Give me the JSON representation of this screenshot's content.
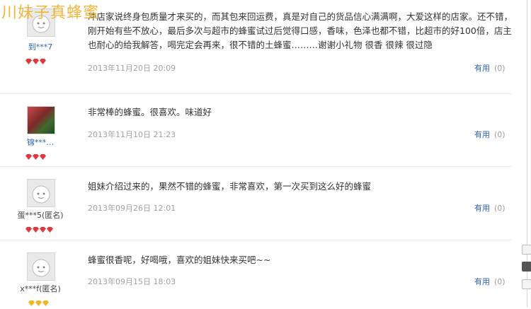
{
  "watermark": "川妹子真蜂蜜",
  "useful_label": "有用",
  "reviews": [
    {
      "user": "到***7",
      "avatar": "default-avatar",
      "rank_color": "#e0383e",
      "content": "冲店家说终身包质量才来买的，而其包来回运费，真是对自己的货品信心满满啊，大爱这样的店家。还不错，刚开始有些不放心，最后多次与超市的蜂蜜试过后觉得口感，香味，色泽也都不错，比超市的好100倍，店主也耐心的给我解答，喝完定会再来，很不错的土蜂蜜………谢谢小礼物 很香 很辣 很过隐",
      "date": "2013年11月20日 20:09",
      "useful_count": "(0)"
    },
    {
      "user": "锦***…",
      "avatar": "photo-avatar",
      "rank_color": "#e0383e",
      "content": "非常棒的蜂蜜。很喜欢。味道好",
      "date": "2013年11月10日 21:23",
      "useful_count": "(0)"
    },
    {
      "user": "蛋***5(匿名)",
      "avatar": "default-avatar",
      "rank_color": "#e0383e",
      "content": "姐妹介绍过来的，果然不错的蜂蜜，非常喜欢，第一次买到这么好的蜂蜜",
      "date": "2013年09月26日 12:01",
      "useful_count": "(0)"
    },
    {
      "user": "x***f(匿名)",
      "avatar": "default-avatar",
      "rank_color": "#f0b71e",
      "content": "蜂蜜很香呢，好喝哦，喜欢的姐妹快来买吧~~",
      "date": "2013年09月15日 18:03",
      "useful_count": "(0)"
    }
  ]
}
